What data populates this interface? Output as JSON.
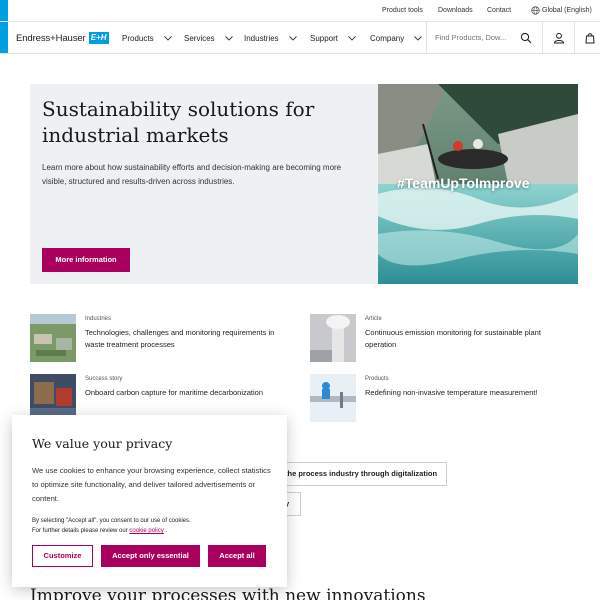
{
  "utility_nav": {
    "product_tools": "Product tools",
    "downloads": "Downloads",
    "contact": "Contact",
    "region": "Global (English)"
  },
  "brand": {
    "name": "Endress+Hauser",
    "mark": "E+H"
  },
  "main_nav": {
    "items": [
      "Products",
      "Services",
      "Industries",
      "Support",
      "Company"
    ]
  },
  "search": {
    "placeholder": "Find Products, Dow..."
  },
  "hero": {
    "title": "Sustainability solutions for industrial markets",
    "description": "Learn more about how sustainability efforts and decision-making are becoming more visible, structured and results-driven across industries.",
    "button": "More information",
    "hashtag": "#TeamUpToImprove"
  },
  "cards": [
    {
      "category": "Industries",
      "title": "Technologies, challenges and monitoring requirements in waste treatment processes"
    },
    {
      "category": "Article",
      "title": "Continuous emission monitoring for sustainable plant operation"
    },
    {
      "category": "Success story",
      "title": "Onboard carbon capture for maritime decarbonization"
    },
    {
      "category": "Products",
      "title": "Redefining non-invasive temperature measurement!"
    }
  ],
  "background_links": {
    "link1_fragment": "the process industry through digitalization",
    "link2_fragment": "y"
  },
  "bottom_heading": "Improve your processes with new innovations",
  "cookie": {
    "title": "We value your privacy",
    "body": "We use cookies to enhance your browsing experience, collect statistics to optimize site functionality, and deliver tailored advertisements or content.",
    "consent_line1": "By selecting \"Accept all\", you consent to our use of cookies.",
    "consent_line2_prefix": "For further details please review our ",
    "policy_link": "cookie policy",
    "consent_line2_suffix": " .",
    "btn_customize": "Customize",
    "btn_essential": "Accept only essential",
    "btn_accept_all": "Accept all"
  },
  "colors": {
    "brand_blue": "#009fe3",
    "accent_magenta": "#a8005c",
    "hero_bg": "#eef1f4"
  }
}
